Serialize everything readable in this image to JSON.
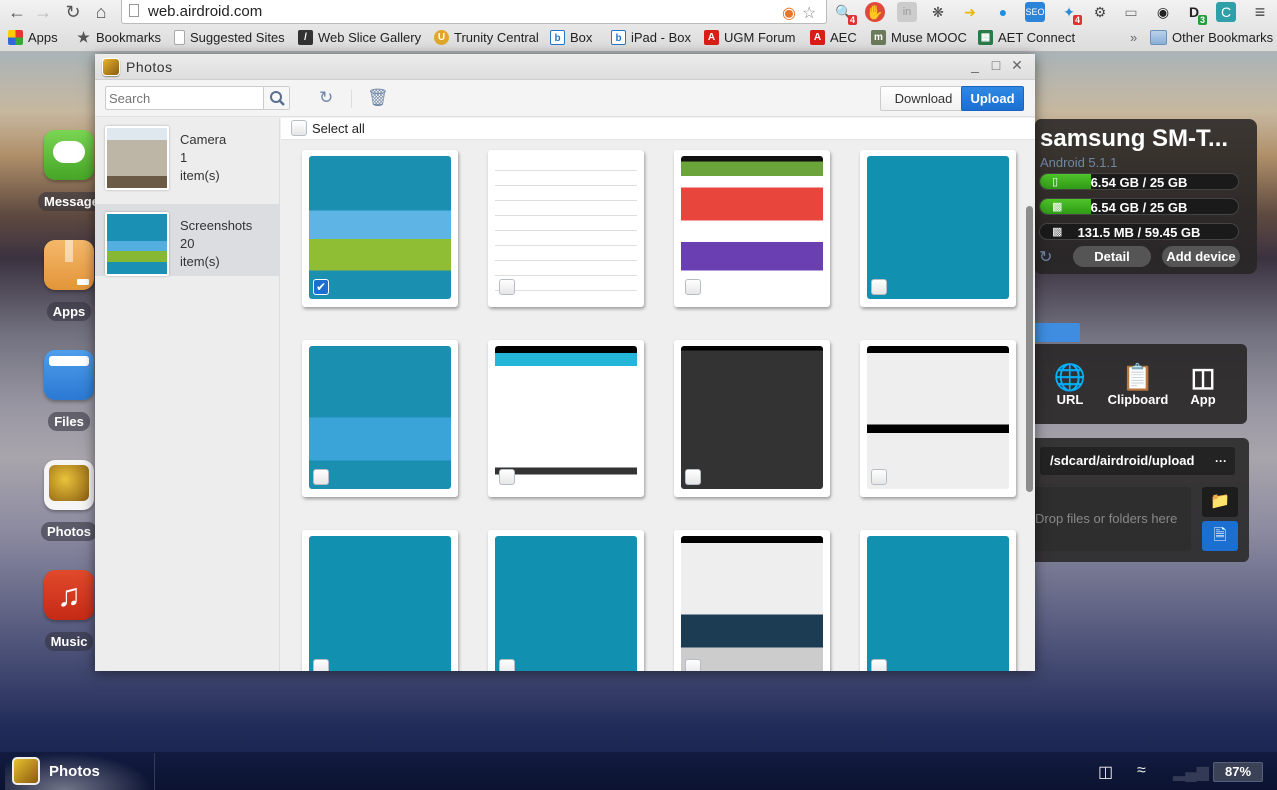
{
  "browser": {
    "url": "web.airdroid.com",
    "extension_badges": {
      "search_ext": "4",
      "bird_ext": "4",
      "d_ext": "3"
    },
    "bookmarks": [
      {
        "label": "Apps",
        "icon": "apps-grid-icon"
      },
      {
        "label": "Bookmarks",
        "icon": "star-icon"
      },
      {
        "label": "Suggested Sites",
        "icon": "page-icon"
      },
      {
        "label": "Web Slice Gallery",
        "icon": "web-slice-icon"
      },
      {
        "label": "Trunity Central",
        "icon": "trunity-icon"
      },
      {
        "label": "Box",
        "icon": "box-icon"
      },
      {
        "label": "iPad - Box",
        "icon": "box-icon"
      },
      {
        "label": "UGM Forum",
        "icon": "adobe-icon"
      },
      {
        "label": "AEC",
        "icon": "adobe-icon"
      },
      {
        "label": "Muse MOOC",
        "icon": "muse-icon"
      },
      {
        "label": "AET Connect",
        "icon": "aet-icon"
      }
    ],
    "overflow_label": "»",
    "other_bookmarks": "Other Bookmarks"
  },
  "dock": [
    {
      "label": "Messages",
      "color": "#5cbf3a"
    },
    {
      "label": "Apps",
      "color": "#eaa24d"
    },
    {
      "label": "Files",
      "color": "#3d8de0"
    },
    {
      "label": "Photos",
      "color": "#c99a22"
    },
    {
      "label": "Music",
      "color": "#d0321c"
    }
  ],
  "photos_window": {
    "title": "Photos",
    "search_placeholder": "Search",
    "download_label": "Download",
    "upload_label": "Upload",
    "select_all_label": "Select all",
    "albums": [
      {
        "name": "Camera",
        "count": "1",
        "unit": "item(s)",
        "active": false
      },
      {
        "name": "Screenshots",
        "count": "20",
        "unit": "item(s)",
        "active": true
      }
    ],
    "photos": [
      {
        "kind": "home-screen",
        "checked": true
      },
      {
        "kind": "list-document",
        "checked": false
      },
      {
        "kind": "play-store",
        "checked": false
      },
      {
        "kind": "apps-drawer",
        "checked": false
      },
      {
        "kind": "home-screen-clock",
        "checked": false
      },
      {
        "kind": "setup-screen",
        "checked": false
      },
      {
        "kind": "dark-update",
        "checked": false
      },
      {
        "kind": "tutorial",
        "checked": false
      },
      {
        "kind": "apps-drawer",
        "checked": false
      },
      {
        "kind": "apps-drawer",
        "checked": false
      },
      {
        "kind": "device-promo",
        "checked": false
      },
      {
        "kind": "apps-drawer",
        "checked": false
      }
    ]
  },
  "device": {
    "name": "samsung SM-T...",
    "os": "Android 5.1.1",
    "storage": [
      {
        "icon": "phone-icon",
        "value": "6.54 GB / 25 GB",
        "used_fraction": 0.26
      },
      {
        "icon": "sdcard-icon",
        "value": "6.54 GB / 25 GB",
        "used_fraction": 0.26
      },
      {
        "icon": "sdcard-icon",
        "value": "131.5 MB / 59.45 GB",
        "used_fraction": 0.002
      }
    ],
    "detail_label": "Detail",
    "add_device_label": "Add device"
  },
  "tools": [
    {
      "label": "URL",
      "icon": "globe-link-icon"
    },
    {
      "label": "Clipboard",
      "icon": "clipboard-icon"
    },
    {
      "label": "App",
      "icon": "app-box-icon"
    }
  ],
  "upload_panel": {
    "path": "/sdcard/airdroid/upload",
    "more": "···",
    "drop_hint": "Drop files or folders here"
  },
  "taskbar": {
    "active_app": "Photos",
    "battery": "87%"
  },
  "colors": {
    "accent": "#1b6fd0",
    "storage_fill": "#3fae1f",
    "panel_bg": "#2a2828"
  }
}
